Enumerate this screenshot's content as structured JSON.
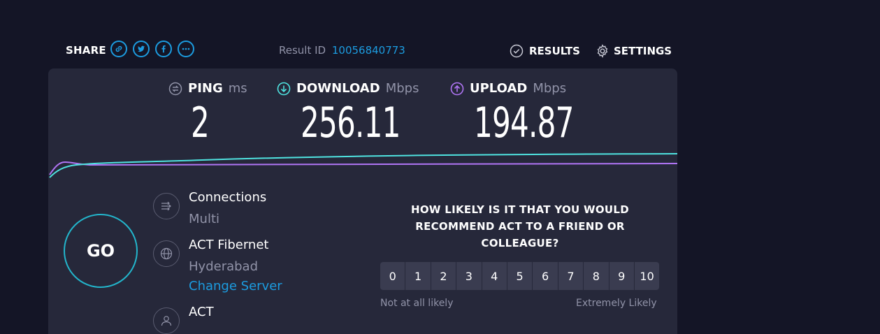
{
  "header": {
    "share_label": "SHARE",
    "share_icons": [
      "link-icon",
      "twitter-icon",
      "facebook-icon",
      "more-icon"
    ],
    "result_id_label": "Result ID",
    "result_id_value": "10056840773",
    "results_label": "RESULTS",
    "settings_label": "SETTINGS"
  },
  "metrics": {
    "ping": {
      "name": "PING",
      "unit": "ms",
      "value": "2"
    },
    "download": {
      "name": "DOWNLOAD",
      "unit": "Mbps",
      "value": "256.11"
    },
    "upload": {
      "name": "UPLOAD",
      "unit": "Mbps",
      "value": "194.87"
    }
  },
  "go_label": "GO",
  "connections": {
    "title": "Connections",
    "value": "Multi"
  },
  "server": {
    "name": "ACT Fibernet",
    "location": "Hyderabad",
    "change_label": "Change Server"
  },
  "provider": {
    "name": "ACT"
  },
  "survey": {
    "question": "HOW LIKELY IS IT THAT YOU WOULD RECOMMEND ACT TO A FRIEND OR COLLEAGUE?",
    "options": [
      "0",
      "1",
      "2",
      "3",
      "4",
      "5",
      "6",
      "7",
      "8",
      "9",
      "10"
    ],
    "low_label": "Not at all likely",
    "high_label": "Extremely Likely"
  },
  "colors": {
    "accent_blue": "#1c9ce0",
    "download": "#4fe3e0",
    "upload": "#b075f5",
    "panel": "#26283a",
    "background": "#141526"
  }
}
